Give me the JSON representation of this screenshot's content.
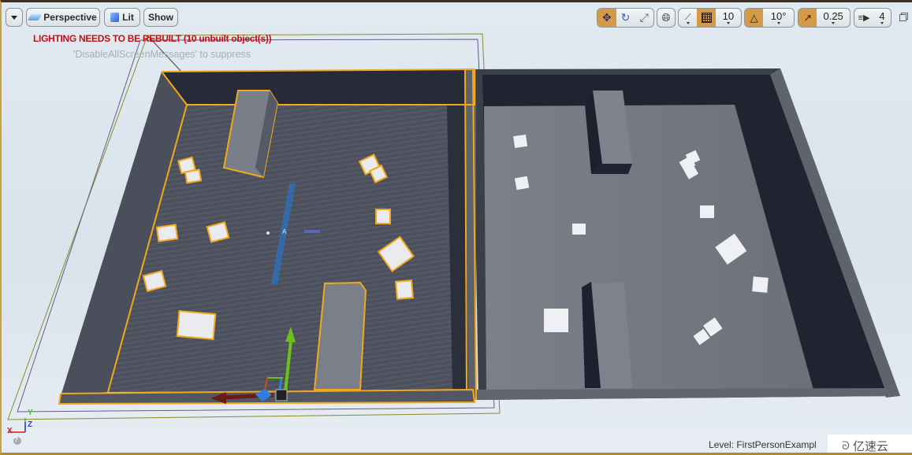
{
  "viewport": {
    "menu_button": {
      "icon": "caret-down-icon"
    },
    "view_mode_button": {
      "label": "Perspective",
      "icon": "perspective-icon"
    },
    "lighting_button": {
      "label": "Lit",
      "icon": "lit-cube-icon"
    },
    "show_button": {
      "label": "Show"
    }
  },
  "toolbar_right": {
    "transform_modes": [
      {
        "name": "translate",
        "icon": "translate-icon",
        "active": true
      },
      {
        "name": "rotate",
        "icon": "rotate-icon",
        "active": false
      },
      {
        "name": "scale",
        "icon": "scale-icon",
        "active": false
      }
    ],
    "coordinate_system": {
      "icon": "world-icon"
    },
    "surface_snapping": {
      "icon": "surface-snap-icon"
    },
    "grid_snap": {
      "icon": "grid-icon",
      "active": true,
      "value": "10"
    },
    "rotation_snap": {
      "icon": "angle-icon",
      "active": true,
      "value": "10°"
    },
    "scale_snap": {
      "icon": "scale-snap-icon",
      "active": true,
      "value": "0.25"
    },
    "camera_speed": {
      "icon": "camera-speed-icon",
      "value": "4"
    },
    "maximize": {
      "icon": "restore-viewport-icon"
    }
  },
  "messages": {
    "lighting_warning": "LIGHTING NEEDS TO BE REBUILT (10 unbuilt object(s))",
    "suppress_hint": "'DisableAllScreenMessages' to suppress"
  },
  "axis_indicator": {
    "x": "X",
    "y": "Y",
    "z": "Z"
  },
  "status": {
    "level_label": "Level:  FirstPersonExampl"
  },
  "watermark": {
    "text": "亿速云"
  },
  "colors": {
    "selection_outline": "#f2a81d",
    "active_toggle": "#d59a45",
    "warning_text": "#c40f16",
    "gizmo_x": "#b8161a",
    "gizmo_y": "#6dbf1c",
    "gizmo_z": "#2f7fe0"
  }
}
